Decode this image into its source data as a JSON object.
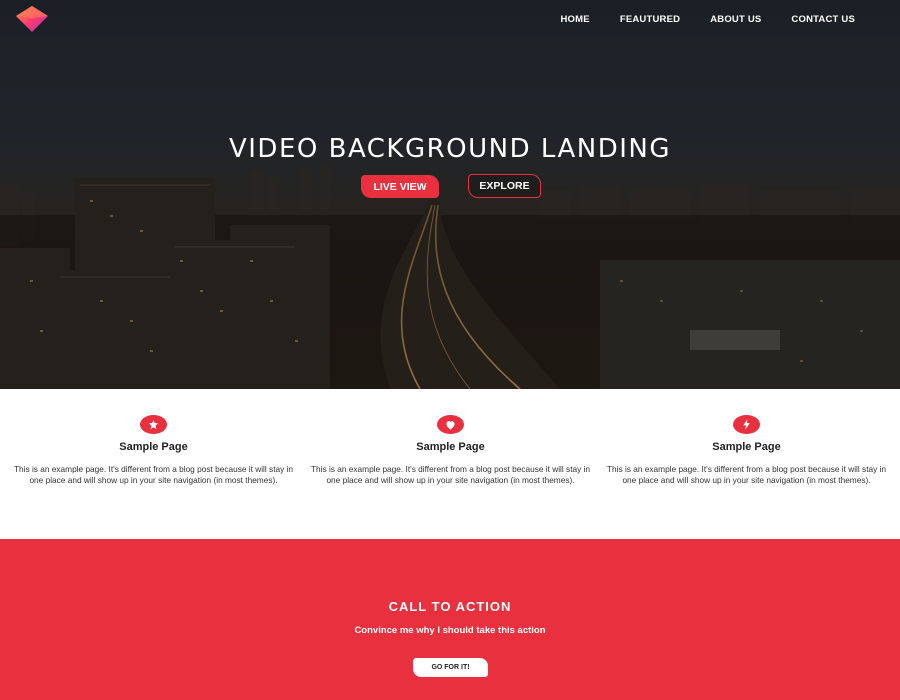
{
  "header": {
    "logo_icon": "diamond-logo-icon",
    "nav": [
      {
        "label": "HOME"
      },
      {
        "label": "FEAUTURED"
      },
      {
        "label": "ABOUT US"
      },
      {
        "label": "CONTACT US"
      }
    ]
  },
  "hero": {
    "title": "VIDEO BACKGROUND LANDING",
    "primary_button": "LIVE VIEW",
    "secondary_button": "EXPLORE"
  },
  "features": [
    {
      "icon": "star-icon",
      "title": "Sample Page",
      "text": "This is an example page. It's different from a blog post because it will stay in one place and will show up in your site navigation (in most themes)."
    },
    {
      "icon": "heart-icon",
      "title": "Sample Page",
      "text": "This is an example page. It's different from a blog post because it will stay in one place and will show up in your site navigation (in most themes)."
    },
    {
      "icon": "lightning-icon",
      "title": "Sample Page",
      "text": "This is an example page. It's different from a blog post because it will stay in one place and will show up in your site navigation (in most themes)."
    }
  ],
  "cta": {
    "title": "CALL TO ACTION",
    "subtitle": "Convince me why I should take this action",
    "button": "GO FOR IT!"
  },
  "colors": {
    "accent": "#e8303e",
    "hero_dark": "#1f252c",
    "white": "#ffffff"
  }
}
